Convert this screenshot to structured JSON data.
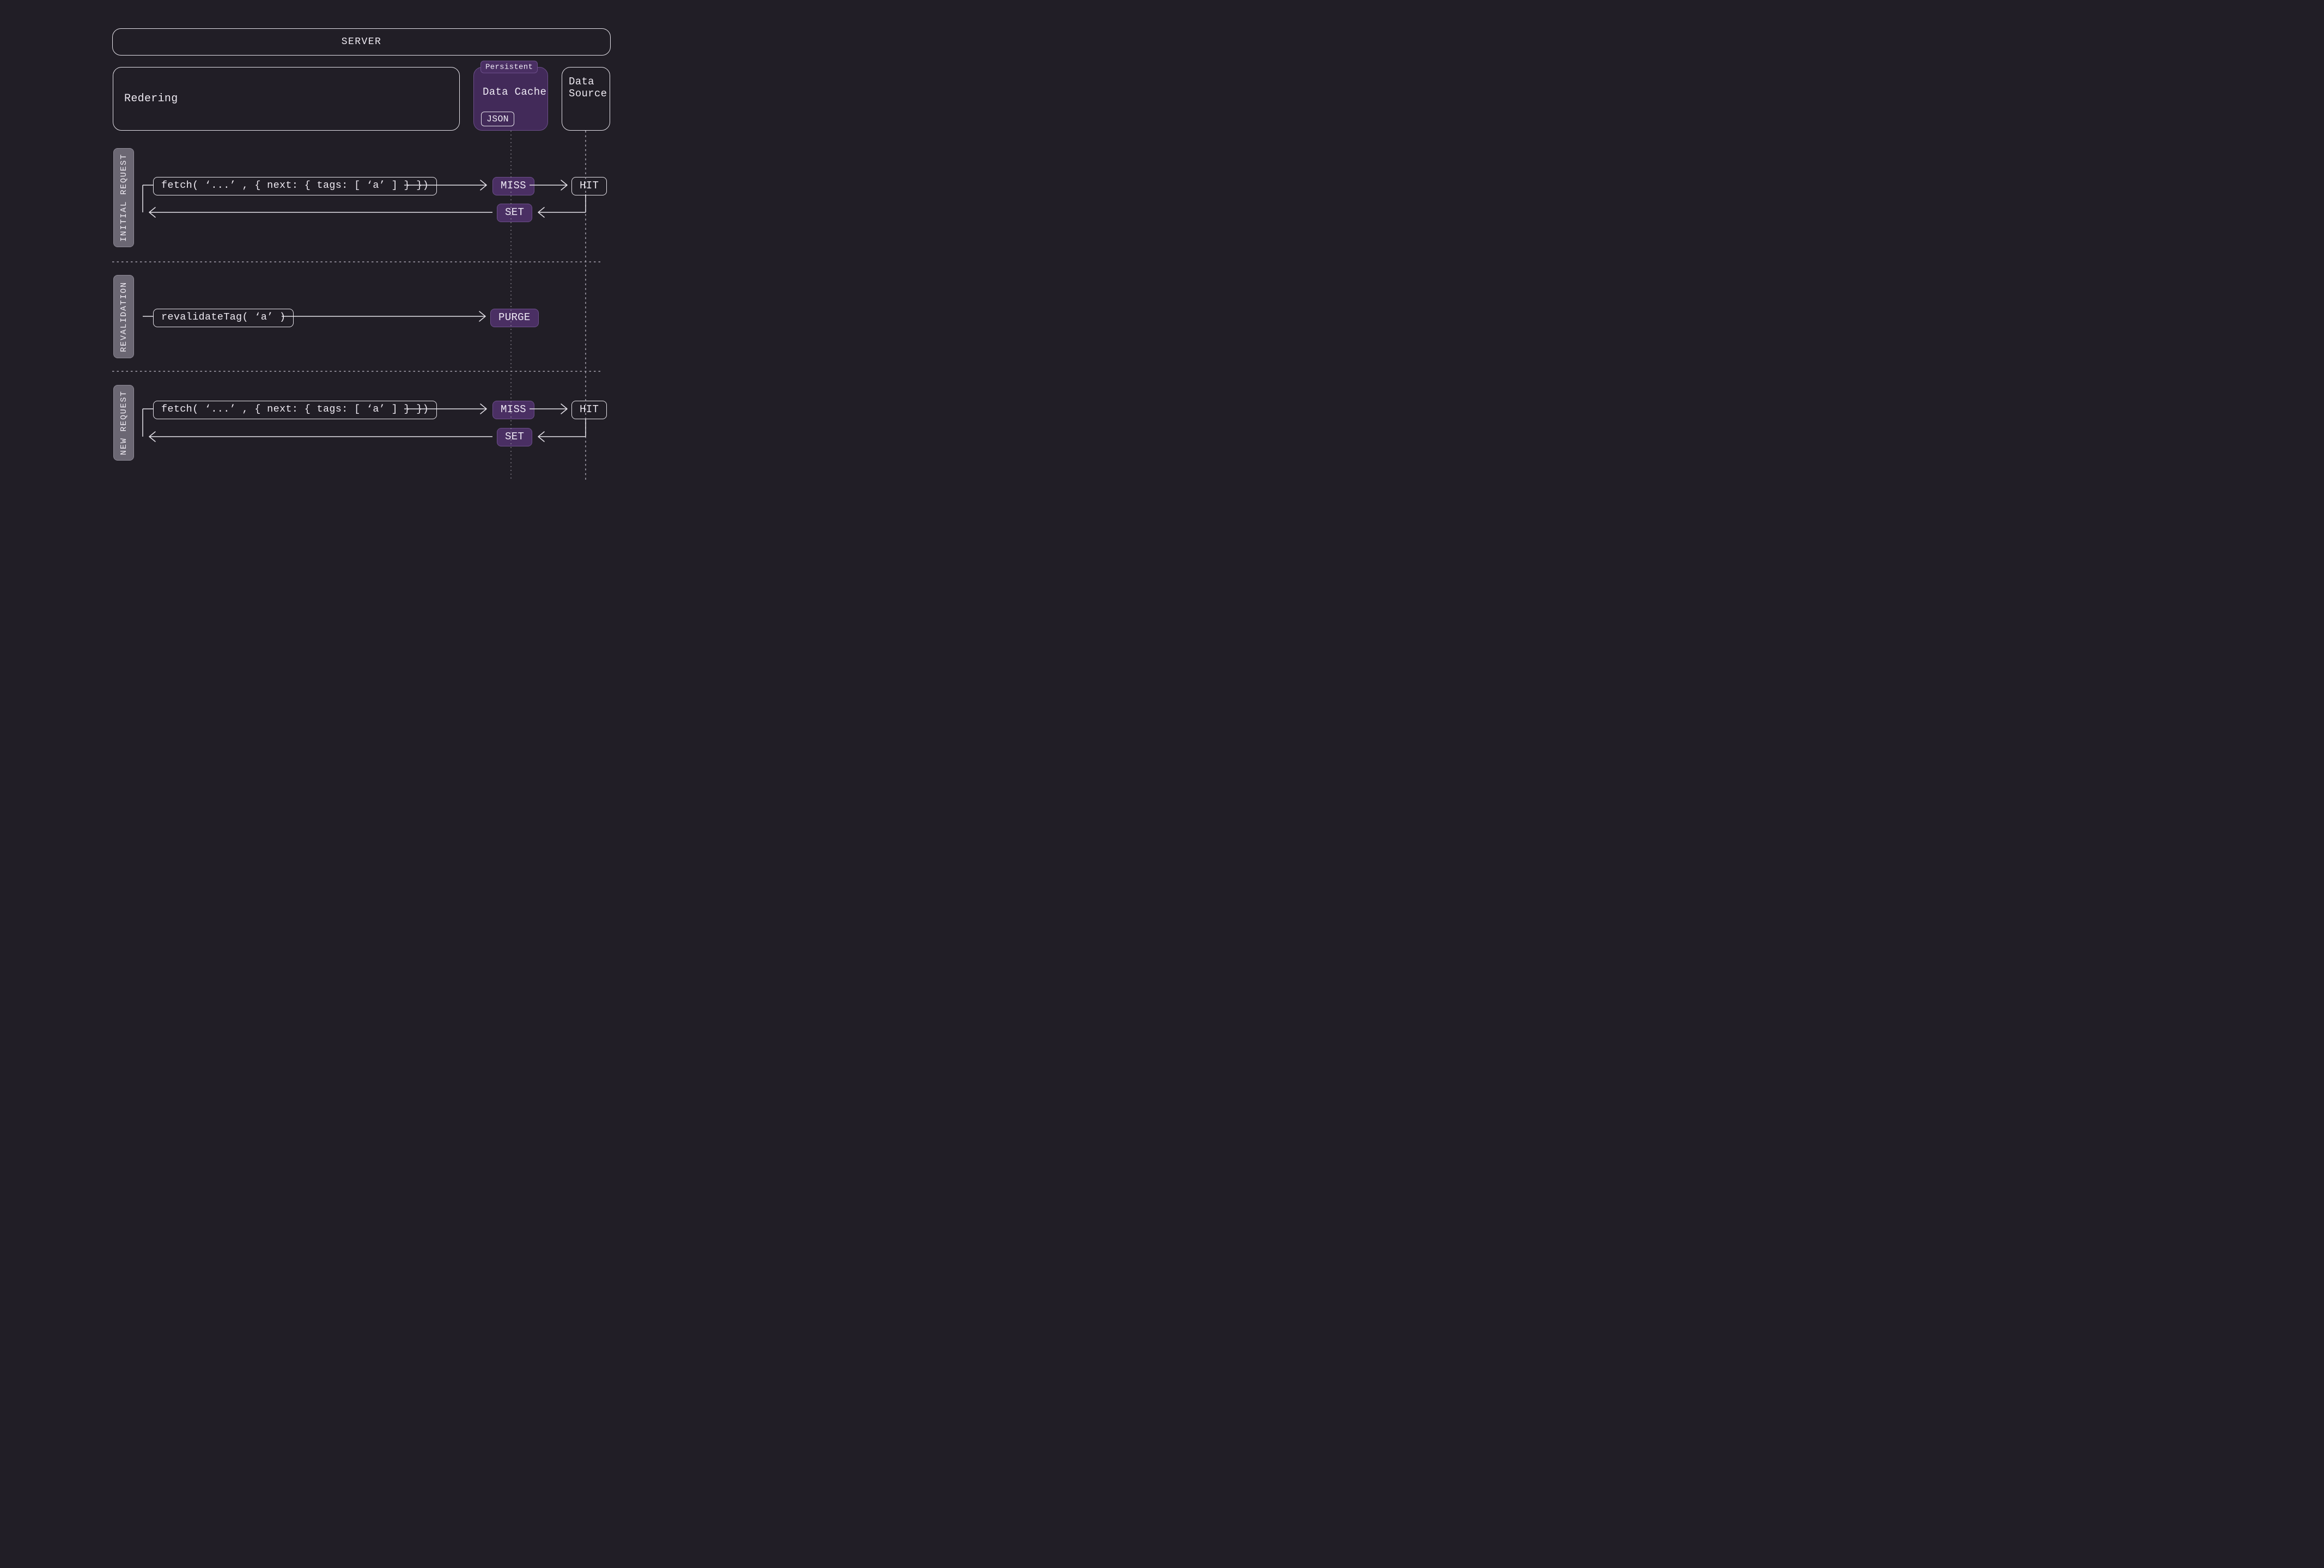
{
  "header": {
    "title": "SERVER"
  },
  "rendering": {
    "title": "Redering"
  },
  "cache": {
    "badge": "Persistent",
    "title": "Data Cache",
    "format": "JSON"
  },
  "source": {
    "title_line1": "Data",
    "title_line2": "Source"
  },
  "sections": {
    "initial": {
      "label": "INITIAL REQUEST"
    },
    "revalidation": {
      "label": "REVALIDATION"
    },
    "new": {
      "label": "NEW REQUEST"
    }
  },
  "calls": {
    "fetchTags": "fetch( ‘...’ , { next: { tags: [ ‘a’ ] } })",
    "revalidateTag": "revalidateTag( ‘a’ )"
  },
  "badges": {
    "miss": "MISS",
    "hit": "HIT",
    "set": "SET",
    "purge": "PURGE"
  }
}
